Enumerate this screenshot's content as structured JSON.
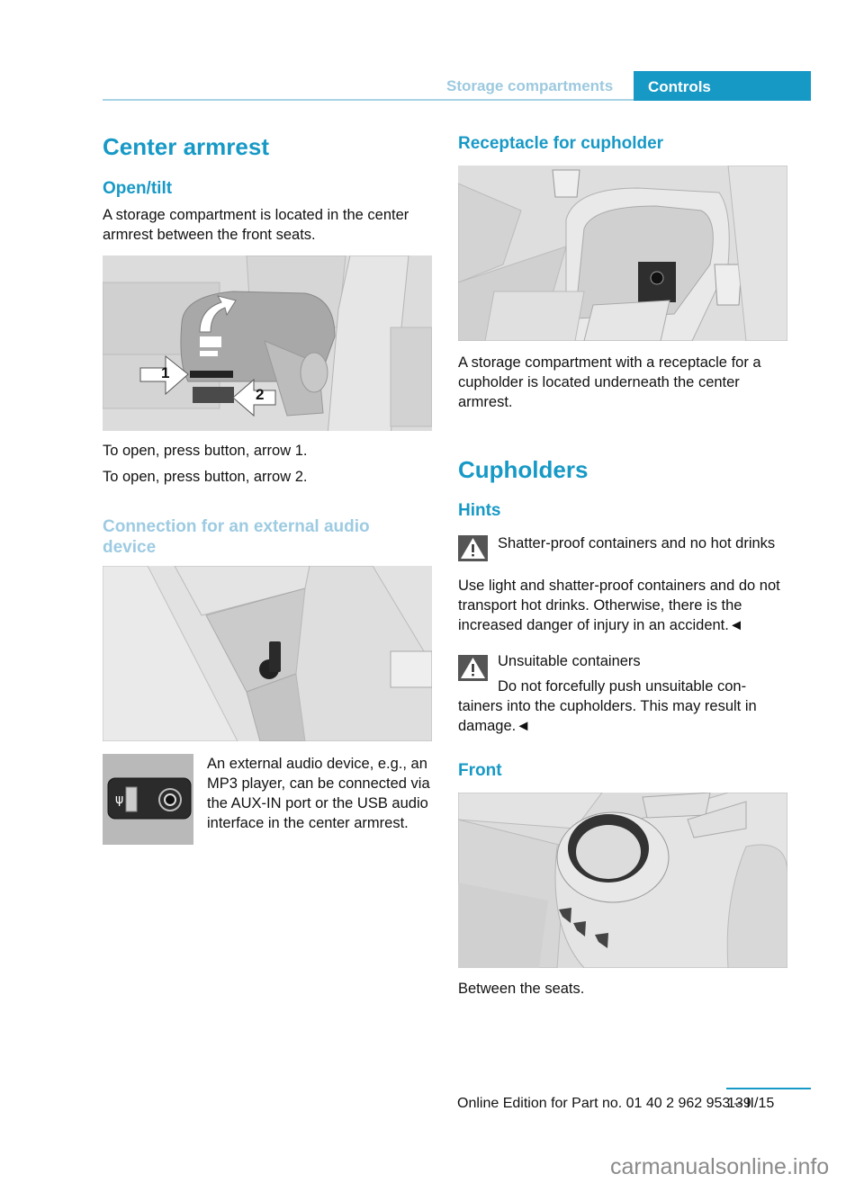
{
  "header": {
    "section": "Storage compartments",
    "chapter": "Controls"
  },
  "left": {
    "title": "Center armrest",
    "open_tilt": {
      "heading": "Open/tilt",
      "text": "A storage compartment is located in the center armrest between the front seats."
    },
    "figure1": {
      "description": "Center armrest illustration with upward arrow and callouts",
      "callouts": [
        "1",
        "2"
      ]
    },
    "instructions": [
      "To open, press button, arrow 1.",
      "To open, press button, arrow 2."
    ],
    "audio": {
      "heading": "Connection for an external audio device",
      "figure_description": "Armrest storage compartment with AUX-IN and USB port",
      "port_labels": [
        "AUX-IN",
        "AUX-IN"
      ],
      "text": "An external audio device, e.g., an MP3 player, can be connected via the AUX-IN port or the USB audio interface in the center armrest."
    }
  },
  "right": {
    "receptacle": {
      "heading": "Receptacle for cupholder",
      "figure_description": "Storage compartment with cupholder receptacle",
      "text": "A storage compartment with a receptacle for a cupholder is located underneath the center armrest."
    },
    "cupholders": {
      "title": "Cupholders",
      "hints_heading": "Hints",
      "warnings": [
        {
          "title": "Shatter-proof containers and no hot drinks",
          "body": "Use light and shatter-proof containers and do not transport hot drinks. Otherwise, there is the increased danger of injury in an accident.◄"
        },
        {
          "title": "Unsuitable containers",
          "body_first": "Do not forcefully push unsuitable con-",
          "body_rest": "tainers into the cupholders. This may result in damage.◄"
        }
      ],
      "front_heading": "Front",
      "front_figure_description": "Front cupholder between the seats",
      "front_caption": "Between the seats."
    }
  },
  "footer": {
    "edition": "Online Edition for Part no. 01 40 2 962 953 – II/15",
    "page_number": "139"
  },
  "watermark": "carmanualsonline.info"
}
